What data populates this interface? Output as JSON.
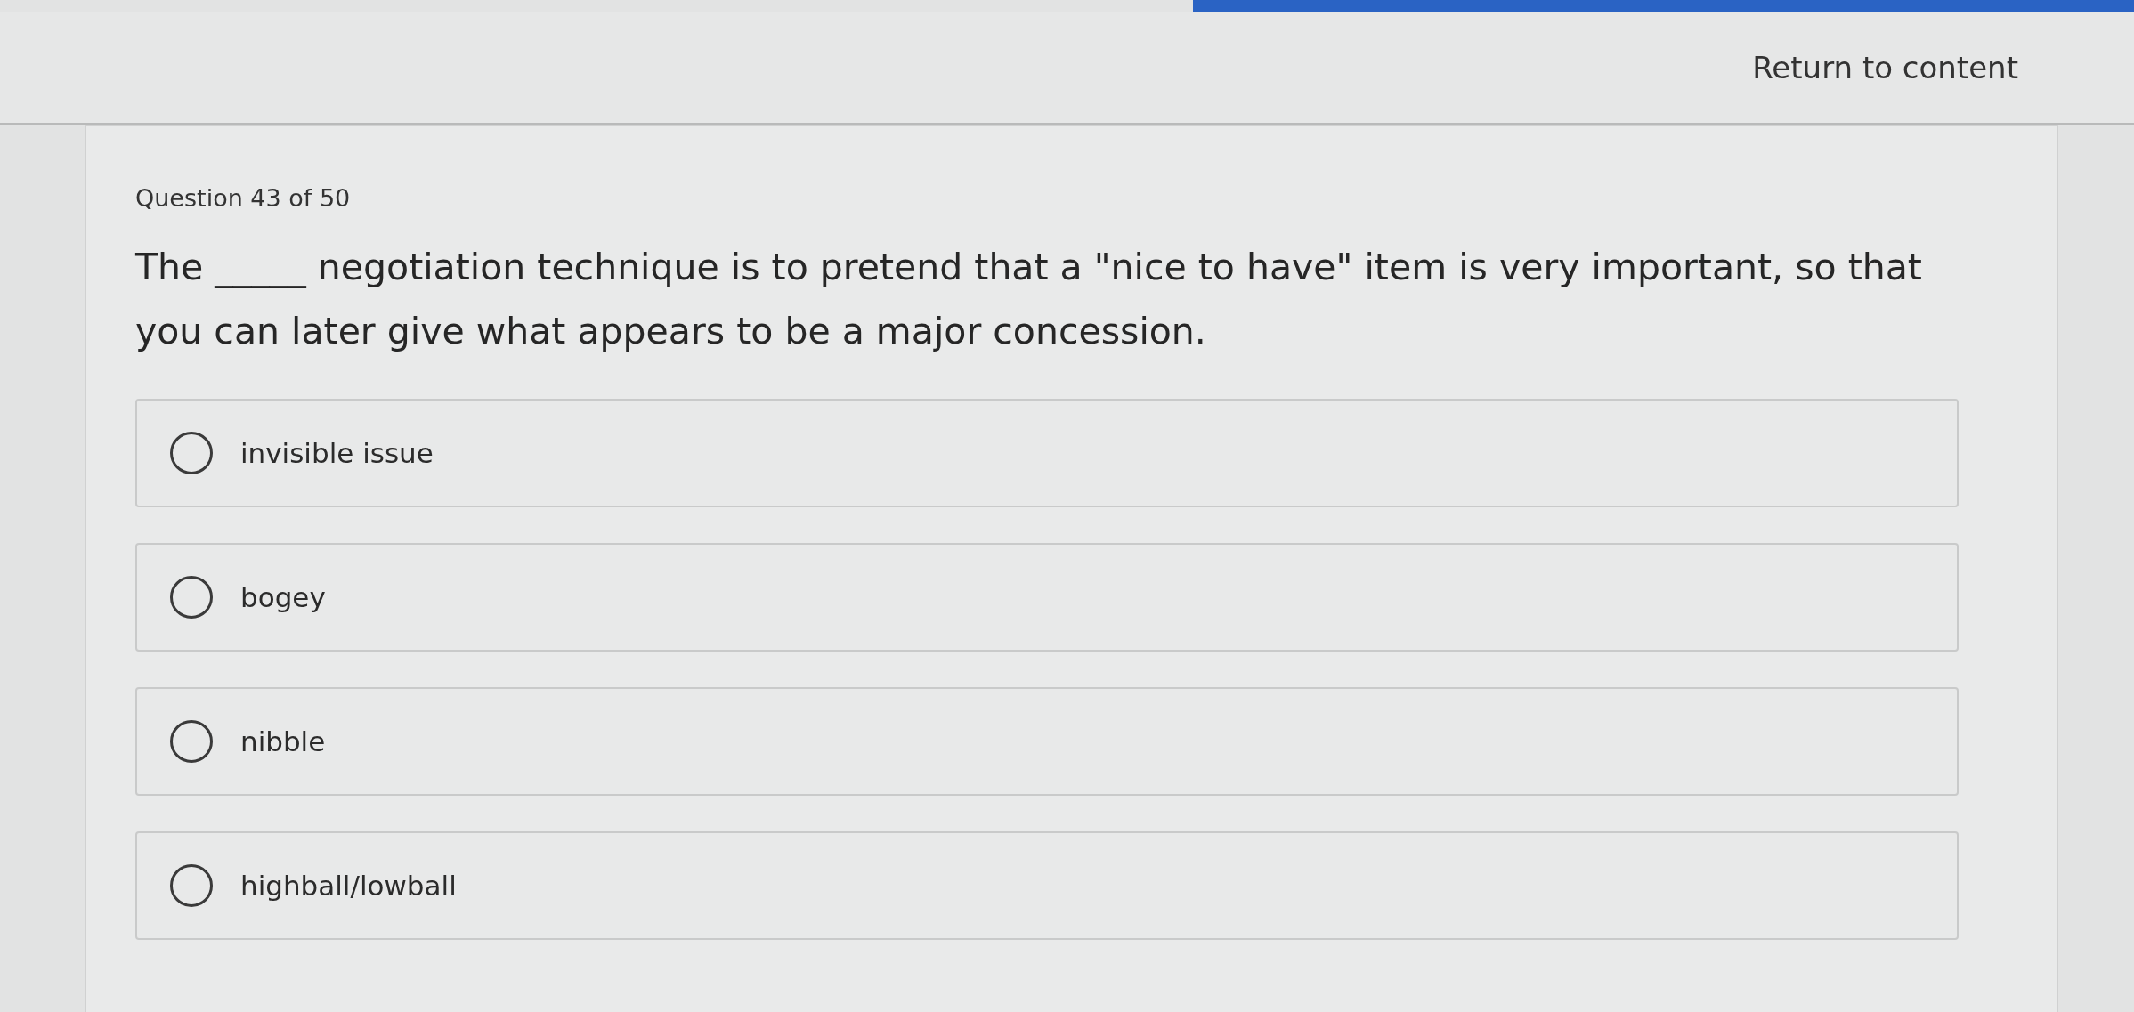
{
  "header": {
    "return_link": "Return to content"
  },
  "question": {
    "counter": "Question 43 of 50",
    "prompt": "The _____ negotiation technique is to pretend that a \"nice to have\" item is very important, so that you can later give what appears to be a major concession."
  },
  "options": [
    {
      "label": "invisible issue",
      "selected": false
    },
    {
      "label": "bogey",
      "selected": false
    },
    {
      "label": "nibble",
      "selected": false
    },
    {
      "label": "highball/lowball",
      "selected": false
    }
  ]
}
